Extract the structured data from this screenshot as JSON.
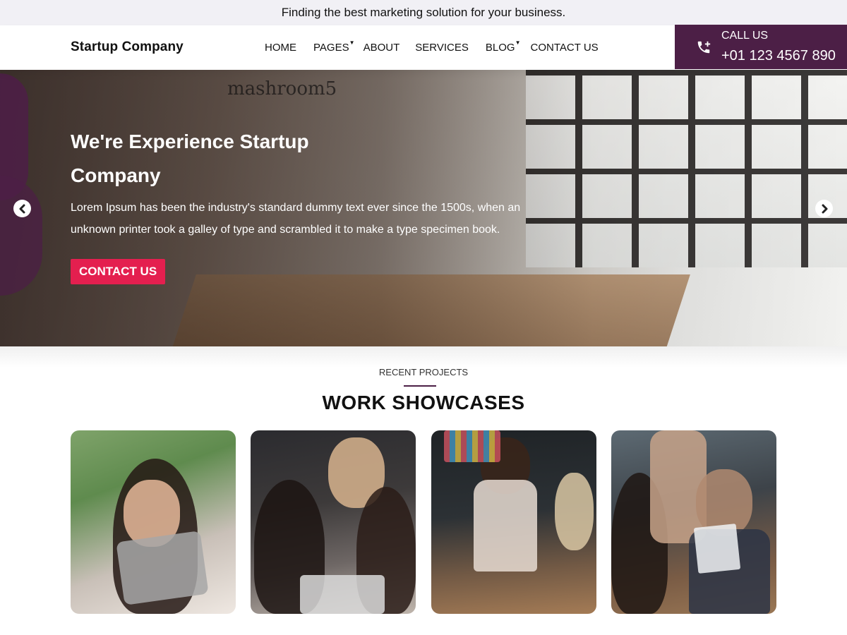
{
  "topbar": {
    "message": "Finding the best marketing solution for your business."
  },
  "header": {
    "brand": "Startup Company",
    "nav": [
      {
        "label": "HOME",
        "has_dropdown": false
      },
      {
        "label": "PAGES",
        "has_dropdown": true
      },
      {
        "label": "ABOUT",
        "has_dropdown": false
      },
      {
        "label": "SERVICES",
        "has_dropdown": false
      },
      {
        "label": "BLOG",
        "has_dropdown": true
      },
      {
        "label": "CONTACT US",
        "has_dropdown": false
      }
    ],
    "call": {
      "label": "CALL US",
      "number": "+01 123 4567 890",
      "icon": "phone-plus-icon"
    }
  },
  "hero": {
    "wall_text": "mashroom5",
    "title": "We're Experience Startup Company",
    "text": "Lorem Ipsum has been the industry's standard dummy text ever since the 1500s, when an unknown printer took a galley of type and scrambled it to make a type specimen book.",
    "cta": "CONTACT US",
    "prev_icon": "chevron-left-circle-icon",
    "next_icon": "chevron-right-circle-icon"
  },
  "showcase": {
    "eyebrow": "RECENT PROJECTS",
    "title": "WORK SHOWCASES",
    "cards": [
      {
        "name": "project-card-1"
      },
      {
        "name": "project-card-2"
      },
      {
        "name": "project-card-3"
      },
      {
        "name": "project-card-4"
      }
    ]
  },
  "colors": {
    "brand_purple": "#4c1f46",
    "cta_red": "#e41f4f",
    "topbar_bg": "#f1f0f5"
  }
}
